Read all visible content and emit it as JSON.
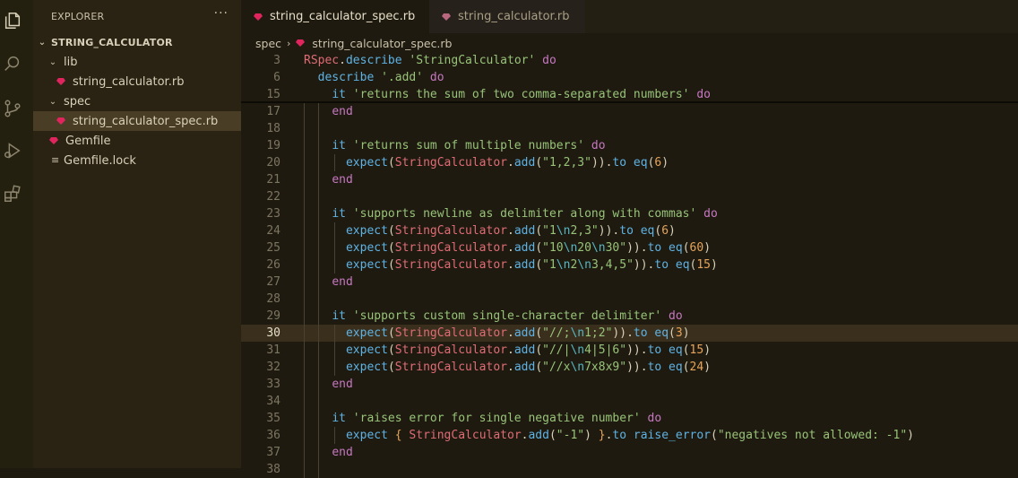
{
  "sidebar": {
    "title": "EXPLORER",
    "more": "···",
    "project": "STRING_CALCULATOR",
    "items": [
      {
        "label": "lib",
        "kind": "folder"
      },
      {
        "label": "string_calculator.rb",
        "kind": "ruby"
      },
      {
        "label": "spec",
        "kind": "folder"
      },
      {
        "label": "string_calculator_spec.rb",
        "kind": "ruby"
      },
      {
        "label": "Gemfile",
        "kind": "ruby"
      },
      {
        "label": "Gemfile.lock",
        "kind": "lock"
      }
    ]
  },
  "tabs": [
    {
      "label": "string_calculator_spec.rb",
      "close": "×"
    },
    {
      "label": "string_calculator.rb"
    }
  ],
  "breadcrumb": {
    "folder": "spec",
    "file": "string_calculator_spec.rb"
  },
  "colors": {
    "ruby": "#e0245e",
    "accent": "#e5a45a"
  },
  "code": [
    {
      "ln": "3",
      "tokens": [
        [
          "c",
          "RSpec"
        ],
        [
          "p",
          "."
        ],
        [
          "m",
          "describe"
        ],
        [
          "p",
          " "
        ],
        [
          "s",
          "'StringCalculator'"
        ],
        [
          "p",
          " "
        ],
        [
          "k",
          "do"
        ]
      ]
    },
    {
      "ln": "6",
      "tokens": [
        [
          "p",
          "  "
        ],
        [
          "m",
          "describe"
        ],
        [
          "p",
          " "
        ],
        [
          "s",
          "'.add'"
        ],
        [
          "p",
          " "
        ],
        [
          "k",
          "do"
        ]
      ]
    },
    {
      "ln": "15",
      "tokens": [
        [
          "p",
          "    "
        ],
        [
          "m",
          "it"
        ],
        [
          "p",
          " "
        ],
        [
          "s",
          "'returns the sum of two comma-separated numbers'"
        ],
        [
          "p",
          " "
        ],
        [
          "k",
          "do"
        ]
      ]
    },
    {
      "ln": "17",
      "tokens": [
        [
          "p",
          "    "
        ],
        [
          "k",
          "end"
        ]
      ]
    },
    {
      "ln": "18",
      "tokens": []
    },
    {
      "ln": "19",
      "tokens": [
        [
          "p",
          "    "
        ],
        [
          "m",
          "it"
        ],
        [
          "p",
          " "
        ],
        [
          "s",
          "'returns sum of multiple numbers'"
        ],
        [
          "p",
          " "
        ],
        [
          "k",
          "do"
        ]
      ]
    },
    {
      "ln": "20",
      "tokens": [
        [
          "p",
          "      "
        ],
        [
          "m",
          "expect"
        ],
        [
          "p",
          "("
        ],
        [
          "c",
          "StringCalculator"
        ],
        [
          "p",
          "."
        ],
        [
          "m",
          "add"
        ],
        [
          "p",
          "("
        ],
        [
          "s",
          "\"1,2,3\""
        ],
        [
          "p",
          "))."
        ],
        [
          "m",
          "to"
        ],
        [
          "p",
          " "
        ],
        [
          "m",
          "eq"
        ],
        [
          "p",
          "("
        ],
        [
          "n",
          "6"
        ],
        [
          "p",
          ")"
        ]
      ]
    },
    {
      "ln": "21",
      "tokens": [
        [
          "p",
          "    "
        ],
        [
          "k",
          "end"
        ]
      ]
    },
    {
      "ln": "22",
      "tokens": []
    },
    {
      "ln": "23",
      "tokens": [
        [
          "p",
          "    "
        ],
        [
          "m",
          "it"
        ],
        [
          "p",
          " "
        ],
        [
          "s",
          "'supports newline as delimiter along with commas'"
        ],
        [
          "p",
          " "
        ],
        [
          "k",
          "do"
        ]
      ]
    },
    {
      "ln": "24",
      "tokens": [
        [
          "p",
          "      "
        ],
        [
          "m",
          "expect"
        ],
        [
          "p",
          "("
        ],
        [
          "c",
          "StringCalculator"
        ],
        [
          "p",
          "."
        ],
        [
          "m",
          "add"
        ],
        [
          "p",
          "("
        ],
        [
          "s",
          "\"1"
        ],
        [
          "e",
          "\\n"
        ],
        [
          "s",
          "2,3\""
        ],
        [
          "p",
          "))."
        ],
        [
          "m",
          "to"
        ],
        [
          "p",
          " "
        ],
        [
          "m",
          "eq"
        ],
        [
          "p",
          "("
        ],
        [
          "n",
          "6"
        ],
        [
          "p",
          ")"
        ]
      ]
    },
    {
      "ln": "25",
      "tokens": [
        [
          "p",
          "      "
        ],
        [
          "m",
          "expect"
        ],
        [
          "p",
          "("
        ],
        [
          "c",
          "StringCalculator"
        ],
        [
          "p",
          "."
        ],
        [
          "m",
          "add"
        ],
        [
          "p",
          "("
        ],
        [
          "s",
          "\"10"
        ],
        [
          "e",
          "\\n"
        ],
        [
          "s",
          "20"
        ],
        [
          "e",
          "\\n"
        ],
        [
          "s",
          "30\""
        ],
        [
          "p",
          "))."
        ],
        [
          "m",
          "to"
        ],
        [
          "p",
          " "
        ],
        [
          "m",
          "eq"
        ],
        [
          "p",
          "("
        ],
        [
          "n",
          "60"
        ],
        [
          "p",
          ")"
        ]
      ]
    },
    {
      "ln": "26",
      "tokens": [
        [
          "p",
          "      "
        ],
        [
          "m",
          "expect"
        ],
        [
          "p",
          "("
        ],
        [
          "c",
          "StringCalculator"
        ],
        [
          "p",
          "."
        ],
        [
          "m",
          "add"
        ],
        [
          "p",
          "("
        ],
        [
          "s",
          "\"1"
        ],
        [
          "e",
          "\\n"
        ],
        [
          "s",
          "2"
        ],
        [
          "e",
          "\\n"
        ],
        [
          "s",
          "3,4,5\""
        ],
        [
          "p",
          "))."
        ],
        [
          "m",
          "to"
        ],
        [
          "p",
          " "
        ],
        [
          "m",
          "eq"
        ],
        [
          "p",
          "("
        ],
        [
          "n",
          "15"
        ],
        [
          "p",
          ")"
        ]
      ]
    },
    {
      "ln": "27",
      "tokens": [
        [
          "p",
          "    "
        ],
        [
          "k",
          "end"
        ]
      ]
    },
    {
      "ln": "28",
      "tokens": []
    },
    {
      "ln": "29",
      "tokens": [
        [
          "p",
          "    "
        ],
        [
          "m",
          "it"
        ],
        [
          "p",
          " "
        ],
        [
          "s",
          "'supports custom single-character delimiter'"
        ],
        [
          "p",
          " "
        ],
        [
          "k",
          "do"
        ]
      ]
    },
    {
      "ln": "30",
      "current": true,
      "tokens": [
        [
          "p",
          "      "
        ],
        [
          "m",
          "expect"
        ],
        [
          "p",
          "("
        ],
        [
          "c",
          "StringCalculator"
        ],
        [
          "p",
          "."
        ],
        [
          "m",
          "add"
        ],
        [
          "p",
          "("
        ],
        [
          "s",
          "\"//;"
        ],
        [
          "e",
          "\\n"
        ],
        [
          "s",
          "1;2\""
        ],
        [
          "p",
          "))."
        ],
        [
          "m",
          "to"
        ],
        [
          "p",
          " "
        ],
        [
          "m",
          "eq"
        ],
        [
          "p",
          "("
        ],
        [
          "n",
          "3"
        ],
        [
          "p",
          ")"
        ]
      ]
    },
    {
      "ln": "31",
      "tokens": [
        [
          "p",
          "      "
        ],
        [
          "m",
          "expect"
        ],
        [
          "p",
          "("
        ],
        [
          "c",
          "StringCalculator"
        ],
        [
          "p",
          "."
        ],
        [
          "m",
          "add"
        ],
        [
          "p",
          "("
        ],
        [
          "s",
          "\"//|"
        ],
        [
          "e",
          "\\n"
        ],
        [
          "s",
          "4|5|6\""
        ],
        [
          "p",
          "))."
        ],
        [
          "m",
          "to"
        ],
        [
          "p",
          " "
        ],
        [
          "m",
          "eq"
        ],
        [
          "p",
          "("
        ],
        [
          "n",
          "15"
        ],
        [
          "p",
          ")"
        ]
      ]
    },
    {
      "ln": "32",
      "tokens": [
        [
          "p",
          "      "
        ],
        [
          "m",
          "expect"
        ],
        [
          "p",
          "("
        ],
        [
          "c",
          "StringCalculator"
        ],
        [
          "p",
          "."
        ],
        [
          "m",
          "add"
        ],
        [
          "p",
          "("
        ],
        [
          "s",
          "\"//x"
        ],
        [
          "e",
          "\\n"
        ],
        [
          "s",
          "7x8x9\""
        ],
        [
          "p",
          "))."
        ],
        [
          "m",
          "to"
        ],
        [
          "p",
          " "
        ],
        [
          "m",
          "eq"
        ],
        [
          "p",
          "("
        ],
        [
          "n",
          "24"
        ],
        [
          "p",
          ")"
        ]
      ]
    },
    {
      "ln": "33",
      "tokens": [
        [
          "p",
          "    "
        ],
        [
          "k",
          "end"
        ]
      ]
    },
    {
      "ln": "34",
      "tokens": []
    },
    {
      "ln": "35",
      "tokens": [
        [
          "p",
          "    "
        ],
        [
          "m",
          "it"
        ],
        [
          "p",
          " "
        ],
        [
          "s",
          "'raises error for single negative number'"
        ],
        [
          "p",
          " "
        ],
        [
          "k",
          "do"
        ]
      ]
    },
    {
      "ln": "36",
      "tokens": [
        [
          "p",
          "      "
        ],
        [
          "m",
          "expect"
        ],
        [
          "p",
          " "
        ],
        [
          "n",
          "{"
        ],
        [
          "p",
          " "
        ],
        [
          "c",
          "StringCalculator"
        ],
        [
          "p",
          "."
        ],
        [
          "m",
          "add"
        ],
        [
          "p",
          "("
        ],
        [
          "s",
          "\"-1\""
        ],
        [
          "p",
          ") "
        ],
        [
          "n",
          "}"
        ],
        [
          "p",
          "."
        ],
        [
          "m",
          "to"
        ],
        [
          "p",
          " "
        ],
        [
          "m",
          "raise_error"
        ],
        [
          "p",
          "("
        ],
        [
          "s",
          "\"negatives not allowed: -1\""
        ],
        [
          "p",
          ")"
        ]
      ]
    },
    {
      "ln": "37",
      "tokens": [
        [
          "p",
          "    "
        ],
        [
          "k",
          "end"
        ]
      ]
    },
    {
      "ln": "38",
      "tokens": []
    }
  ]
}
